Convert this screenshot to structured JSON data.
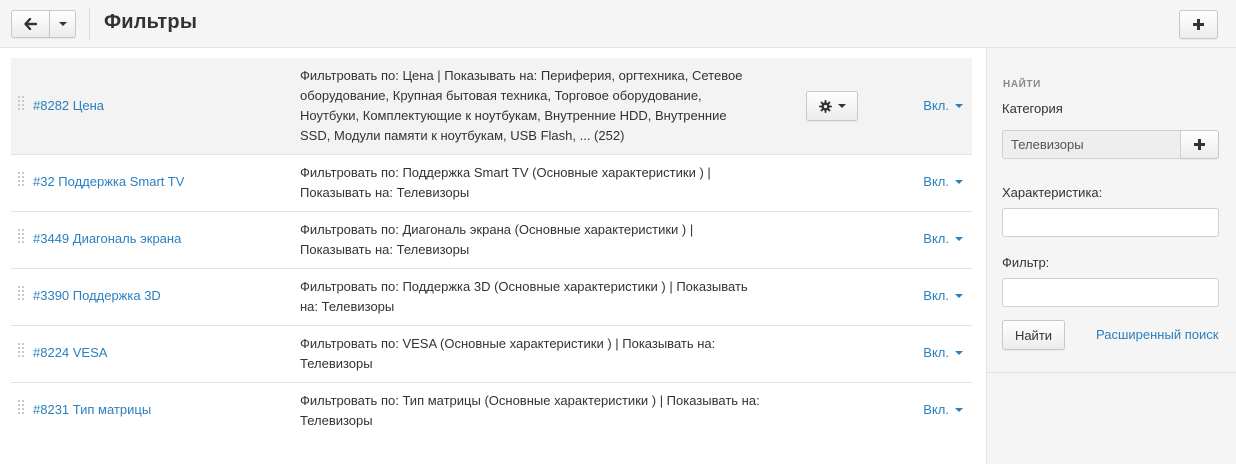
{
  "header": {
    "title": "Фильтры"
  },
  "filters": [
    {
      "name": "#8282 Цена",
      "description": "Фильтровать по: Цена | Показывать на: Периферия, оргтехника, Сетевое оборудование, Крупная бытовая техника, Торговое оборудование, Ноутбуки, Комплектующие к ноутбукам, Внутренние HDD, Внутренние SSD, Модули памяти к ноутбукам, USB Flash, ... (252)",
      "status": "Вкл."
    },
    {
      "name": "#32 Поддержка Smart TV",
      "description": "Фильтровать по: Поддержка Smart TV (Основные характеристики ) | Показывать на: Телевизоры",
      "status": "Вкл."
    },
    {
      "name": "#3449 Диагональ экрана",
      "description": "Фильтровать по: Диагональ экрана (Основные характеристики ) | Показывать на: Телевизоры",
      "status": "Вкл."
    },
    {
      "name": "#3390 Поддержка 3D",
      "description": "Фильтровать по: Поддержка 3D (Основные характеристики ) | Показывать на: Телевизоры",
      "status": "Вкл."
    },
    {
      "name": "#8224 VESA",
      "description": "Фильтровать по: VESA (Основные характеристики ) | Показывать на: Телевизоры",
      "status": "Вкл."
    },
    {
      "name": "#8231 Тип матрицы",
      "description": "Фильтровать по: Тип матрицы (Основные характеристики ) | Показывать на: Телевизоры",
      "status": "Вкл."
    }
  ],
  "sidebar": {
    "heading": "НАЙТИ",
    "category_label": "Категория",
    "category_value": "Телевизоры",
    "feature_label": "Характеристика:",
    "feature_value": "",
    "filter_label": "Фильтр:",
    "filter_value": "",
    "search_label": "Найти",
    "advanced_label": "Расширенный поиск"
  }
}
